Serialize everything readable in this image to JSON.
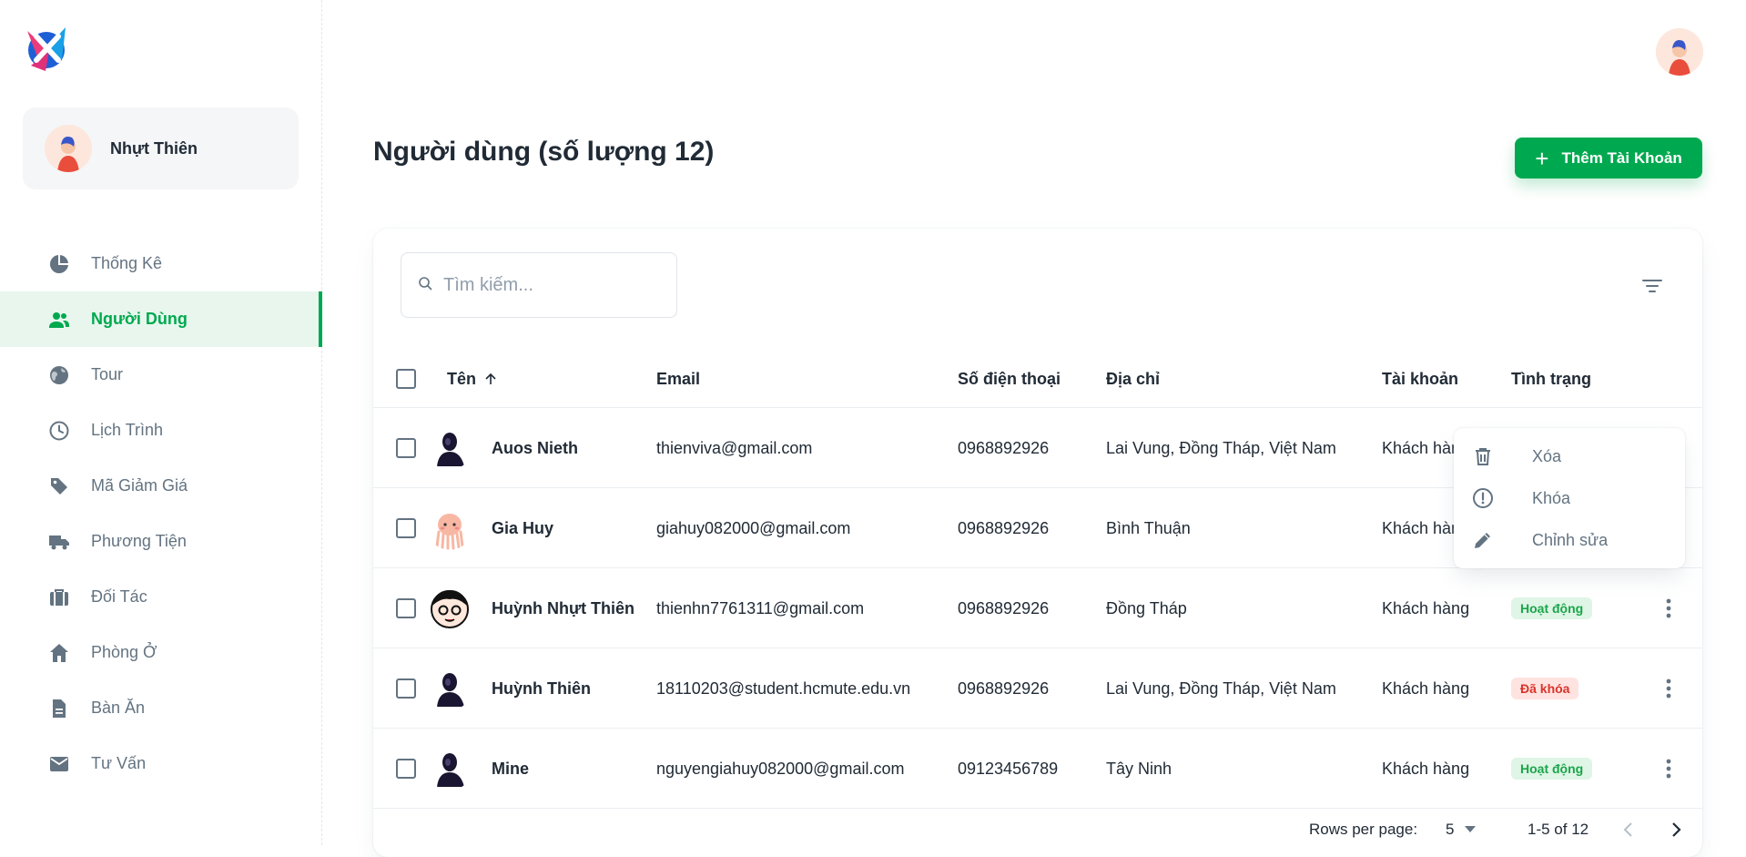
{
  "user": {
    "name": "Nhựt Thiên"
  },
  "nav": [
    {
      "label": "Thống Kê",
      "icon": "pie-chart-icon"
    },
    {
      "label": "Người Dùng",
      "icon": "people-icon",
      "active": true
    },
    {
      "label": "Tour",
      "icon": "globe-icon"
    },
    {
      "label": "Lịch Trình",
      "icon": "clock-icon"
    },
    {
      "label": "Mã Giảm Giá",
      "icon": "tag-icon"
    },
    {
      "label": "Phương Tiện",
      "icon": "truck-icon"
    },
    {
      "label": "Đối Tác",
      "icon": "briefcase-icon"
    },
    {
      "label": "Phòng Ở",
      "icon": "home-icon"
    },
    {
      "label": "Bàn Ăn",
      "icon": "document-icon"
    },
    {
      "label": "Tư Vấn",
      "icon": "mail-icon"
    }
  ],
  "page": {
    "title": "Người dùng (số lượng 12)",
    "add_button": "Thêm Tài Khoản"
  },
  "search": {
    "placeholder": "Tìm kiếm..."
  },
  "table": {
    "headers": {
      "name": "Tên",
      "email": "Email",
      "phone": "Số điện thoại",
      "address": "Địa chỉ",
      "account": "Tài khoản",
      "status": "Tình trạng"
    },
    "rows": [
      {
        "name": "Auos Nieth",
        "email": "thienviva@gmail.com",
        "phone": "0968892926",
        "address": "Lai Vung, Đồng Tháp, Việt Nam",
        "account": "Khách hàng",
        "status": "",
        "avatar": "dark"
      },
      {
        "name": "Gia Huy",
        "email": "giahuy082000@gmail.com",
        "phone": "0968892926",
        "address": "Bình Thuận",
        "account": "Khách hàng",
        "status": "",
        "avatar": "octopus"
      },
      {
        "name": "Huỳnh Nhựt Thiên",
        "email": "thienhn7761311@gmail.com",
        "phone": "0968892926",
        "address": "Đồng Tháp",
        "account": "Khách hàng",
        "status": "Hoạt động",
        "status_type": "active",
        "avatar": "cartoon"
      },
      {
        "name": "Huỳnh Thiên",
        "email": "18110203@student.hcmute.edu.vn",
        "phone": "0968892926",
        "address": "Lai Vung, Đồng Tháp, Việt Nam",
        "account": "Khách hàng",
        "status": "Đã khóa",
        "status_type": "locked",
        "avatar": "dark"
      },
      {
        "name": "Mine",
        "email": "nguyengiahuy082000@gmail.com",
        "phone": "09123456789",
        "address": "Tây Ninh",
        "account": "Khách hàng",
        "status": "Hoạt động",
        "status_type": "active",
        "avatar": "dark"
      }
    ]
  },
  "pagination": {
    "rows_label": "Rows per page:",
    "rows_value": "5",
    "range": "1-5 of 12"
  },
  "context_menu": [
    {
      "label": "Xóa",
      "icon": "trash-icon"
    },
    {
      "label": "Khóa",
      "icon": "alert-circle-icon"
    },
    {
      "label": "Chỉnh sửa",
      "icon": "pencil-icon"
    }
  ],
  "colors": {
    "primary": "#00a94f",
    "text": "#212b36",
    "muted": "#637381",
    "active_badge": "#dff5e6",
    "locked_badge": "#ffe3e0"
  }
}
